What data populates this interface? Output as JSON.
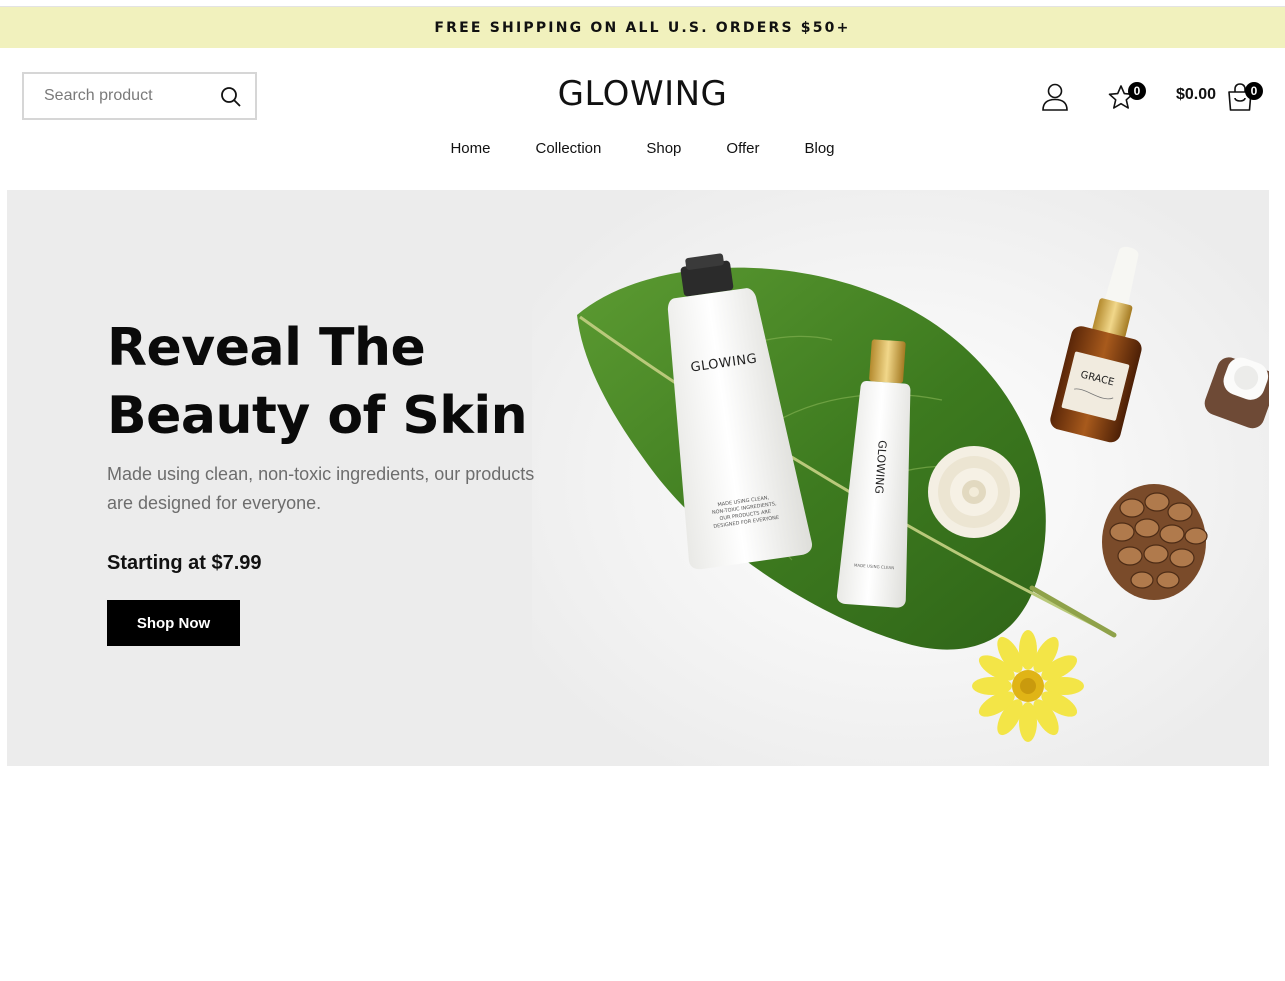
{
  "announcement": {
    "text": "FREE SHIPPING ON ALL U.S. ORDERS $50+"
  },
  "header": {
    "search": {
      "placeholder": "Search product"
    },
    "logo": "GLOWING",
    "wishlist_count": "0",
    "cart_total": "$0.00",
    "cart_count": "0"
  },
  "nav": {
    "items": [
      {
        "label": "Home"
      },
      {
        "label": "Collection"
      },
      {
        "label": "Shop"
      },
      {
        "label": "Offer"
      },
      {
        "label": "Blog"
      }
    ]
  },
  "hero": {
    "title_line1": "Reveal The",
    "title_line2": "Beauty of Skin",
    "subtitle": "Made using clean, non-toxic ingredients, our products are designed for everyone.",
    "price_text": "Starting at $7.99",
    "button_label": "Shop Now",
    "product_labels": {
      "tube_large": "GLOWING",
      "tube_small": "GLOWING",
      "bottle": "GRACE",
      "tube_fine_print": "MADE USING CLEAN, NON-TOXIC INGREDIENTS, OUR PRODUCTS ARE DESIGNED FOR EVERYONE"
    }
  },
  "colors": {
    "announcement_bg": "#f1f1bd",
    "hero_bg": "#ececec",
    "button_bg": "#000000",
    "leaf_green": "#3f7a22",
    "flower_yellow": "#f3e547",
    "amber_bottle": "#8a4513"
  },
  "icons": {
    "search": "search-icon",
    "account": "user-icon",
    "wishlist": "star-icon",
    "cart": "shopping-bag-icon"
  }
}
